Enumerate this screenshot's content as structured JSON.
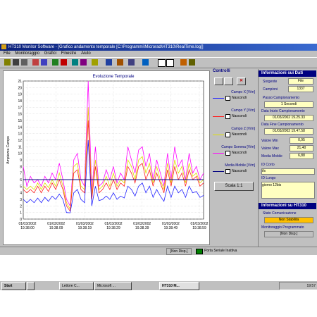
{
  "window": {
    "title": "HT310 Monitor Software - [Grafico andamento temporale [C:\\Programmi\\Microrad\\HT310\\RealTime.log]]"
  },
  "menu": [
    "File",
    "Monitoraggio",
    "Grafici",
    "Finestre",
    "Aiuto"
  ],
  "controls": {
    "title": "Controlli",
    "groups": [
      {
        "label": "Campo X [V/m]",
        "hide": "Nascondi",
        "color": "#2020ff"
      },
      {
        "label": "Campo Y [V/m]",
        "hide": "Nascondi",
        "color": "#ff2020"
      },
      {
        "label": "Campo Z [V/m]",
        "hide": "Nascondi",
        "color": "#e0e000"
      },
      {
        "label": "Campo Somma [V/m]",
        "hide": "Nascondi",
        "color": "#ff00ff"
      },
      {
        "label": "Media Mobile [V/m]",
        "hide": "Nascondi",
        "color": "#000080"
      }
    ],
    "scale_button": "Scala 1:1"
  },
  "info": {
    "header_data": "Informazioni sui Dati",
    "sorgente_label": "Sorgente",
    "sorgente_value": "File",
    "campioni_label": "Campioni",
    "campioni_value": "1337",
    "passo_label": "Passo Campionamento",
    "passo_value": "1 Secondi",
    "inizio_label": "Data Inizio Campionamento",
    "inizio_value": "01/03/2002 19.25.33",
    "fine_label": "Data Fine Campionamento",
    "fine_value": "01/03/2002 19.47.58",
    "min_label": "Valore Min",
    "min_value": "0,95",
    "max_label": "Valore Max",
    "max_value": "21,40",
    "media_label": "Media Mobile",
    "media_value": "6,88",
    "id_corto_label": "ID Corto",
    "id_corto_value": "ifs",
    "id_lungo_label": "ID Lungo",
    "id_lungo_value": "giorno 12bis",
    "header_ht": "Informazioni su HT310",
    "stato_label": "Stato Comunicazione",
    "stato_value": "Non Stabilita",
    "monitor_label": "Monitoraggio Programmato",
    "monitor_value": "[Non Disp.]"
  },
  "status": {
    "left": "[Non Disp.]",
    "port": "Porta Seriale Inattiva"
  },
  "taskbar": {
    "start": "Start",
    "tasks": [
      "Lettore C...",
      "Microsoft ...",
      "HT310 M..."
    ],
    "clock": "19:57"
  },
  "chart_data": {
    "type": "line",
    "title": "Evoluzione Temporale",
    "ylabel": "Ampiezza Campo",
    "xlabel": "",
    "ylim": [
      0,
      21
    ],
    "x_tick_labels": [
      "01/03/2002 19.38.00",
      "01/03/2002 19.38.09",
      "01/03/2002 19.38.19",
      "01/03/2002 19.38.29",
      "01/03/2002 19.38.39",
      "01/03/2002 19.38.49",
      "01/03/2002 19.38.59"
    ],
    "y_ticks": [
      0,
      1,
      2,
      3,
      4,
      5,
      6,
      7,
      8,
      9,
      10,
      11,
      12,
      13,
      14,
      15,
      16,
      17,
      18,
      19,
      20,
      21
    ],
    "grid": true,
    "series": [
      {
        "name": "Campo Somma [V/m]",
        "color": "#ff00ff",
        "values": [
          8,
          5,
          6.5,
          5.5,
          6,
          5,
          6.5,
          5.5,
          7,
          6,
          8.5,
          6,
          3,
          2,
          9,
          10,
          6,
          5,
          21,
          4,
          11,
          5,
          5.5,
          7.5,
          6,
          8,
          5.5,
          7,
          6,
          11,
          9,
          7,
          10.5,
          11,
          8,
          10,
          6,
          9,
          7,
          5,
          10,
          6,
          11,
          8,
          9,
          6,
          10,
          7,
          8,
          6,
          7
        ]
      },
      {
        "name": "Campo Z [V/m]",
        "color": "#e0e000",
        "values": [
          5,
          4.5,
          5,
          4.5,
          5.5,
          4.5,
          5.5,
          4.8,
          6,
          5,
          7,
          5,
          2.5,
          1.5,
          8,
          8.5,
          5,
          4.5,
          17,
          3.5,
          9,
          4.5,
          5,
          6.5,
          5,
          7,
          5,
          6,
          5.5,
          9,
          8,
          6,
          9,
          9.5,
          7,
          8.5,
          5.5,
          8,
          6,
          4.5,
          8.5,
          5.5,
          9,
          7,
          8,
          5.5,
          8.5,
          6.5,
          7,
          5.5,
          6
        ]
      },
      {
        "name": "Campo Y [V/m]",
        "color": "#ff2020",
        "values": [
          4.5,
          4,
          4.5,
          4,
          5,
          4,
          5,
          4.2,
          5.5,
          4.5,
          6,
          4.5,
          2,
          1.2,
          7,
          7.5,
          4.5,
          4,
          15,
          3,
          8,
          4,
          4.5,
          5.5,
          4.5,
          6,
          4.5,
          5.5,
          5,
          8,
          7,
          5.5,
          8,
          8.5,
          6,
          7.5,
          5,
          7,
          5.5,
          4,
          7.5,
          5,
          8,
          6,
          7,
          5,
          7.5,
          6,
          6.5,
          5,
          5.5
        ]
      },
      {
        "name": "Campo X [V/m]",
        "color": "#2020ff",
        "values": [
          3,
          2.5,
          3,
          2.5,
          3.2,
          2.5,
          3.3,
          2.7,
          3.5,
          3,
          3.8,
          3,
          1,
          0.95,
          4,
          4.5,
          3,
          2.5,
          12,
          2,
          5,
          2.8,
          3,
          3.5,
          3,
          4,
          3,
          3.5,
          3.2,
          5,
          4.5,
          3.5,
          5,
          5.5,
          4,
          5,
          3.3,
          4.5,
          3.5,
          2.7,
          5,
          3.3,
          5,
          4,
          4.5,
          3.3,
          5,
          4,
          4.2,
          3.3,
          3.6
        ]
      },
      {
        "name": "Media Mobile [V/m]",
        "color": "#000080",
        "values": [
          6,
          6,
          6,
          6,
          6,
          6,
          6,
          6,
          6,
          6,
          6,
          6,
          6,
          6,
          6,
          6,
          6,
          6,
          6,
          6,
          6,
          6,
          6,
          6,
          6,
          6,
          6,
          6,
          6,
          6,
          6,
          6,
          6,
          6,
          6,
          6,
          6,
          6,
          6,
          6,
          6,
          6,
          6,
          6,
          6,
          6,
          6,
          6,
          6,
          6,
          6
        ]
      }
    ]
  }
}
